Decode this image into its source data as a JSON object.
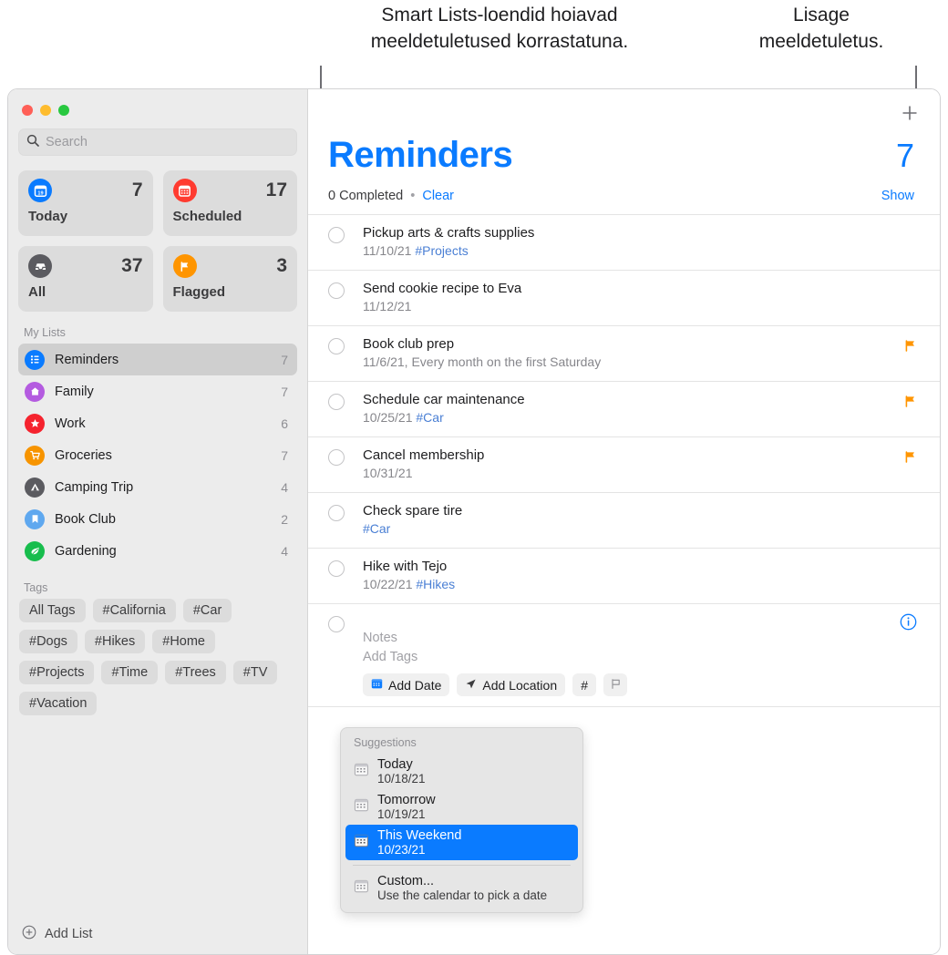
{
  "callouts": {
    "left": "Smart Lists-loendid hoiavad\nmeeldetuletused korrastatuna.",
    "right": "Lisage\nmeeldetuletus."
  },
  "sidebar": {
    "search": {
      "value": "",
      "placeholder": "Search",
      "icon": "search-icon"
    },
    "smart_cards": [
      {
        "label": "Today",
        "count": "7",
        "icon": "calendar-today-icon",
        "color": "#0a7bff"
      },
      {
        "label": "Scheduled",
        "count": "17",
        "icon": "calendar-icon",
        "color": "#ff3b30"
      },
      {
        "label": "All",
        "count": "37",
        "icon": "inbox-tray-icon",
        "color": "#5b5b60"
      },
      {
        "label": "Flagged",
        "count": "3",
        "icon": "flag-icon",
        "color": "#ff9500"
      }
    ],
    "my_lists_header": "My Lists",
    "lists": [
      {
        "name": "Reminders",
        "count": "7",
        "icon": "bullet-list-icon",
        "color": "#0a7bff",
        "selected": true
      },
      {
        "name": "Family",
        "count": "7",
        "icon": "house-icon",
        "color": "#b45be0",
        "selected": false
      },
      {
        "name": "Work",
        "count": "6",
        "icon": "star-icon",
        "color": "#f5232e",
        "selected": false
      },
      {
        "name": "Groceries",
        "count": "7",
        "icon": "cart-icon",
        "color": "#f79400",
        "selected": false
      },
      {
        "name": "Camping Trip",
        "count": "4",
        "icon": "tent-icon",
        "color": "#5b5b60",
        "selected": false
      },
      {
        "name": "Book Club",
        "count": "2",
        "icon": "bookmark-icon",
        "color": "#5fa8ef",
        "selected": false
      },
      {
        "name": "Gardening",
        "count": "4",
        "icon": "leaf-icon",
        "color": "#18bd4d",
        "selected": false
      }
    ],
    "tags_header": "Tags",
    "tags": [
      "All Tags",
      "#California",
      "#Car",
      "#Dogs",
      "#Hikes",
      "#Home",
      "#Projects",
      "#Time",
      "#Trees",
      "#TV",
      "#Vacation"
    ],
    "add_list_label": "Add List"
  },
  "main": {
    "add_button_icon": "plus-icon",
    "title": "Reminders",
    "count": "7",
    "completed_text": "0 Completed",
    "separator": "•",
    "clear_label": "Clear",
    "show_label": "Show",
    "reminders": [
      {
        "title": "Pickup arts & crafts supplies",
        "date": "11/10/21",
        "tag": "#Projects",
        "flagged": false
      },
      {
        "title": "Send cookie recipe to Eva",
        "date": "11/12/21",
        "tag": "",
        "flagged": false
      },
      {
        "title": "Book club prep",
        "date": "11/6/21, Every month on the first Saturday",
        "tag": "",
        "flagged": true
      },
      {
        "title": "Schedule car maintenance",
        "date": "10/25/21",
        "tag": "#Car",
        "flagged": true
      },
      {
        "title": "Cancel membership",
        "date": "10/31/21",
        "tag": "",
        "flagged": true
      },
      {
        "title": "Check spare tire",
        "date": "",
        "tag": "#Car",
        "flagged": false
      },
      {
        "title": "Hike with Tejo",
        "date": "10/22/21",
        "tag": "#Hikes",
        "flagged": false
      }
    ],
    "new_reminder": {
      "notes_placeholder": "Notes",
      "tags_placeholder": "Add Tags",
      "add_date_label": "Add Date",
      "add_location_label": "Add Location",
      "hash_label": "#",
      "flag_icon": "flag-outline-icon",
      "info_icon": "info-circle-icon"
    }
  },
  "suggestions": {
    "header": "Suggestions",
    "items": [
      {
        "label": "Today",
        "sub": "10/18/21",
        "selected": false
      },
      {
        "label": "Tomorrow",
        "sub": "10/19/21",
        "selected": false
      },
      {
        "label": "This Weekend",
        "sub": "10/23/21",
        "selected": true
      },
      {
        "label": "Custom...",
        "sub": "Use the calendar to pick a date",
        "selected": false
      }
    ]
  },
  "colors": {
    "accent": "#0a7bff",
    "flag": "#ff9500",
    "traffic_red": "#ff5f57",
    "traffic_yellow": "#febc2e",
    "traffic_green": "#28c840"
  }
}
